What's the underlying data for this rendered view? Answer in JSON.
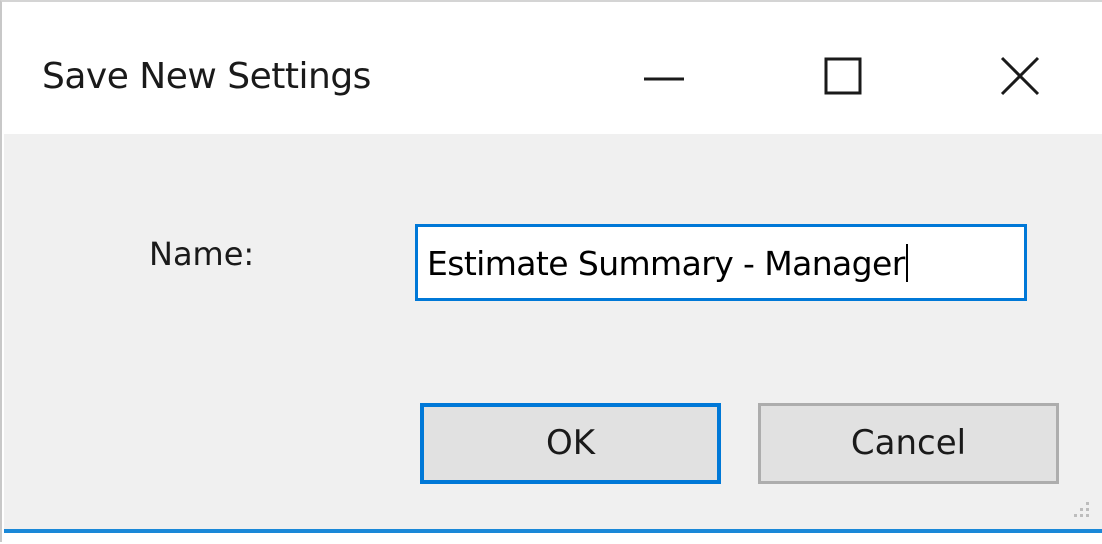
{
  "window": {
    "title": "Save New Settings"
  },
  "title_controls": {
    "minimize_icon": "minimize-icon",
    "maximize_icon": "maximize-icon",
    "close_icon": "close-icon"
  },
  "form": {
    "name_label": "Name:",
    "name_value": "Estimate Summary - Manager"
  },
  "buttons": {
    "ok_label": "OK",
    "cancel_label": "Cancel"
  },
  "colors": {
    "accent": "#0078d7",
    "client_bg": "#f0f0f0",
    "button_bg": "#e1e1e1"
  }
}
